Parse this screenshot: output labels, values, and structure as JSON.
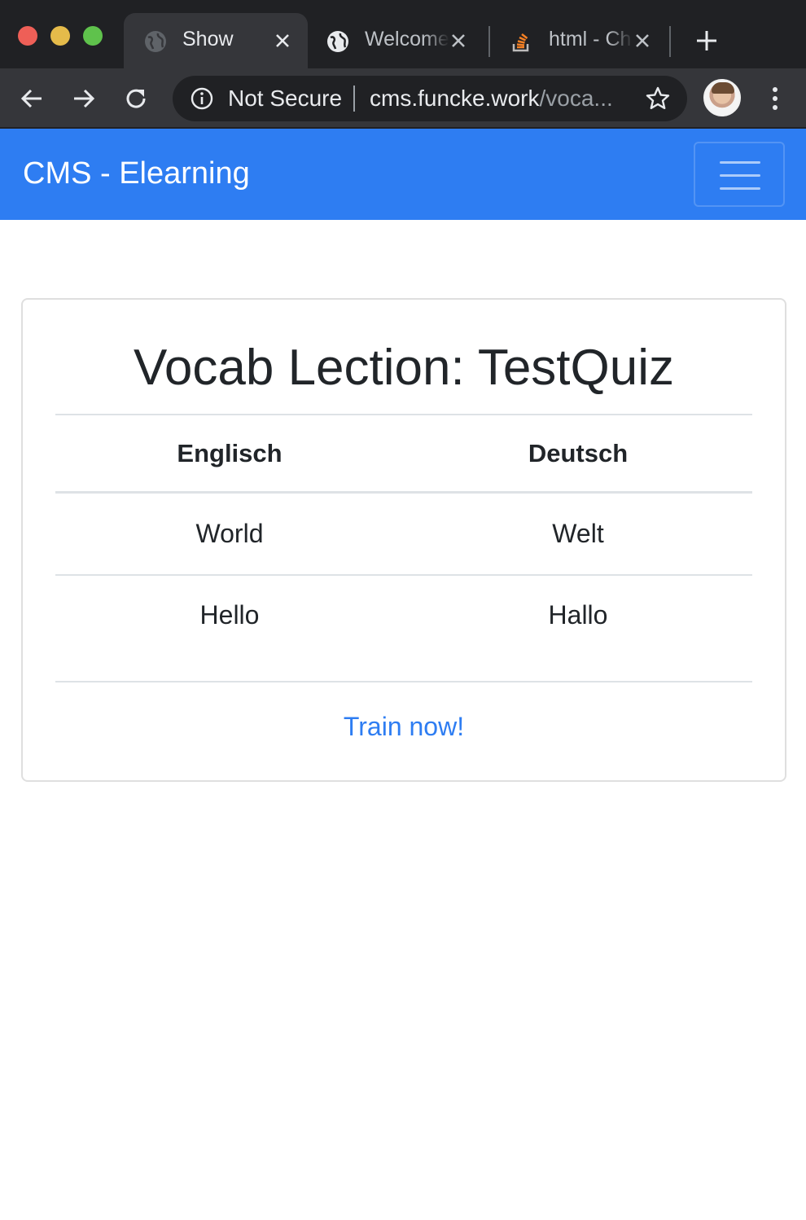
{
  "browser": {
    "tabs": [
      {
        "title": "Show",
        "icon": "globe-icon",
        "active": true
      },
      {
        "title": "Welcome",
        "icon": "globe-icon",
        "active": false
      },
      {
        "title": "html - Ch",
        "icon": "stackoverflow-icon",
        "active": false
      }
    ],
    "omnibox": {
      "security_label": "Not Secure",
      "host": "cms.funcke.work",
      "path": "/voca..."
    },
    "colors": {
      "tabbar": "#202124",
      "toolbar": "#35363a",
      "close": "#ee5f57",
      "minimize": "#e5bb4a",
      "maximize": "#5fc24c"
    }
  },
  "navbar": {
    "brand": "CMS - Elearning",
    "color": "#2e7df2",
    "toggler_icon": "hamburger-icon"
  },
  "card": {
    "title": "Vocab Lection: TestQuiz",
    "columns": [
      "Englisch",
      "Deutsch"
    ],
    "rows": [
      [
        "World",
        "Welt"
      ],
      [
        "Hello",
        "Hallo"
      ]
    ],
    "link": "Train now!"
  }
}
